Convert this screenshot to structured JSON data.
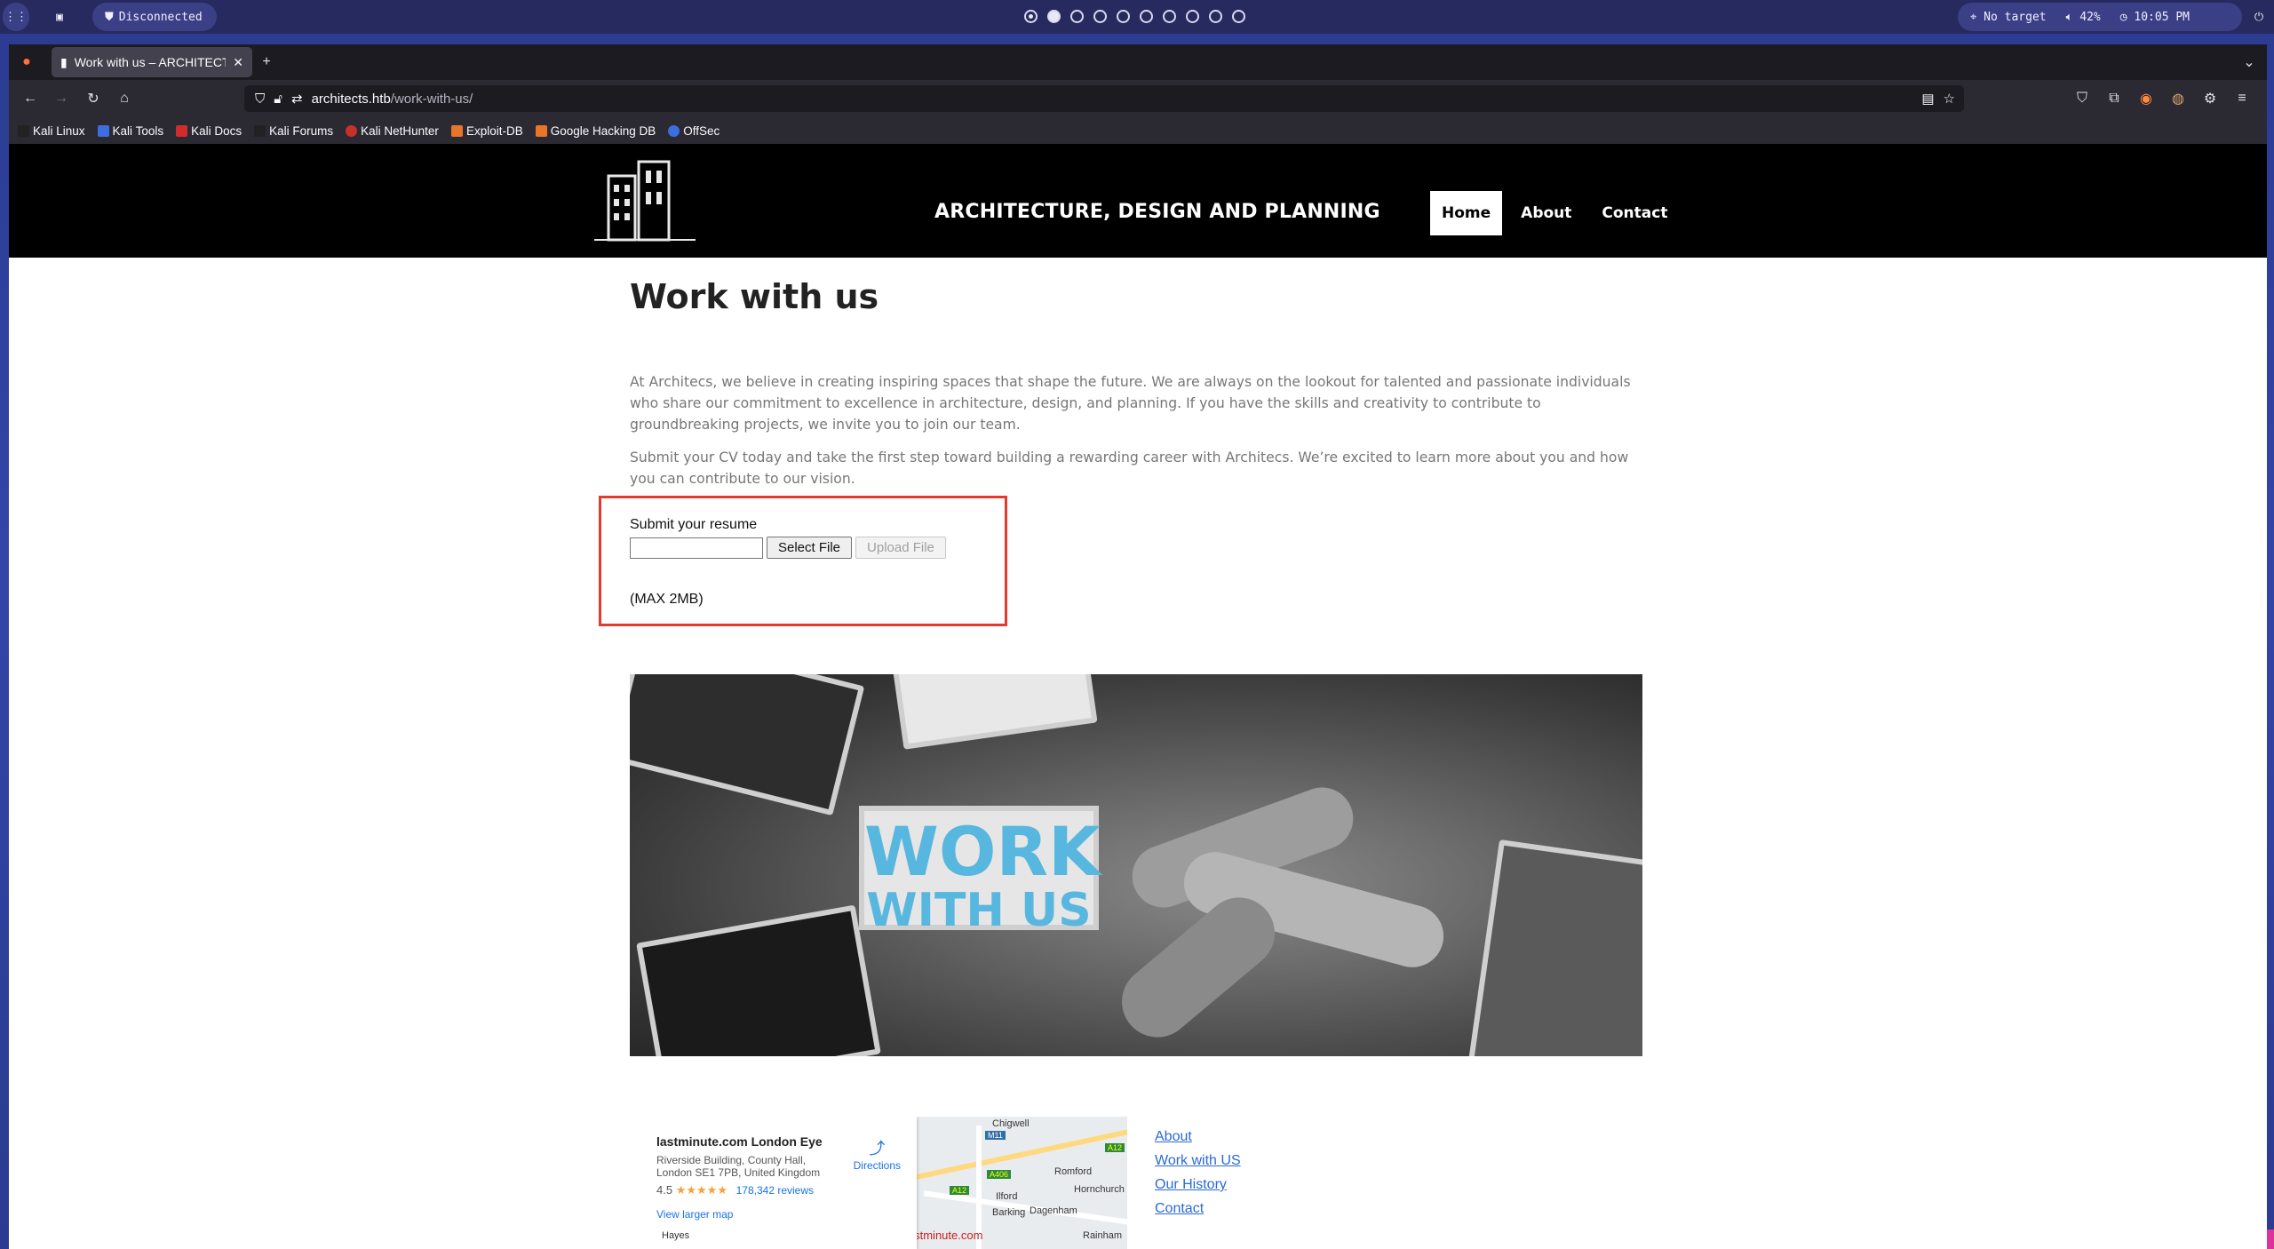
{
  "panel": {
    "vpn_status": "Disconnected",
    "target": "No target",
    "volume": "42%",
    "time": "10:05 PM"
  },
  "browser": {
    "tab_title": "Work with us – ARCHITECT",
    "url_domain": "architects.htb",
    "url_path": "/work-with-us/",
    "bookmarks": [
      "Kali Linux",
      "Kali Tools",
      "Kali Docs",
      "Kali Forums",
      "Kali NetHunter",
      "Exploit-DB",
      "Google Hacking DB",
      "OffSec"
    ]
  },
  "site": {
    "title": "ARCHITECTURE, DESIGN AND PLANNING",
    "nav": [
      "Home",
      "About",
      "Contact"
    ],
    "heading": "Work with us",
    "para1": "At Architecs, we believe in creating inspiring spaces that shape the future. We are always on the lookout for talented and passionate individuals who share our commitment to excellence in architecture, design, and planning. If you have the skills and creativity to contribute to groundbreaking projects, we invite you to join our team.",
    "para2": "Submit your CV today and take the first step toward building a rewarding career with Architecs. We’re excited to learn more about you and how you can contribute to our vision.",
    "form": {
      "label": "Submit your resume",
      "select_button": "Select File",
      "upload_button": "Upload File",
      "max_note": "(MAX 2MB)"
    },
    "hero_text_line1": "WORK",
    "hero_text_line2": "WITH US",
    "map": {
      "place": "lastminute.com London Eye",
      "address_line1": "Riverside Building, County Hall,",
      "address_line2": "London SE1 7PB, United Kingdom",
      "rating": "4.5",
      "stars": "★★★★★",
      "reviews": "178,342 reviews",
      "directions": "Directions",
      "larger_map": "View larger map",
      "labels": [
        "Chigwell",
        "Romford",
        "Hornchurch",
        "Ilford",
        "Barking",
        "Dagenham",
        "Rainham",
        "Hayes",
        "lastminute.com",
        "M11",
        "A12",
        "A12",
        "A406"
      ]
    },
    "footer_links": [
      "About",
      "Work with US",
      "Our History",
      "Contact"
    ]
  },
  "colors": {
    "highlight_border": "#e23b2c",
    "header_bg": "#000000",
    "link": "#2a6ad6"
  }
}
